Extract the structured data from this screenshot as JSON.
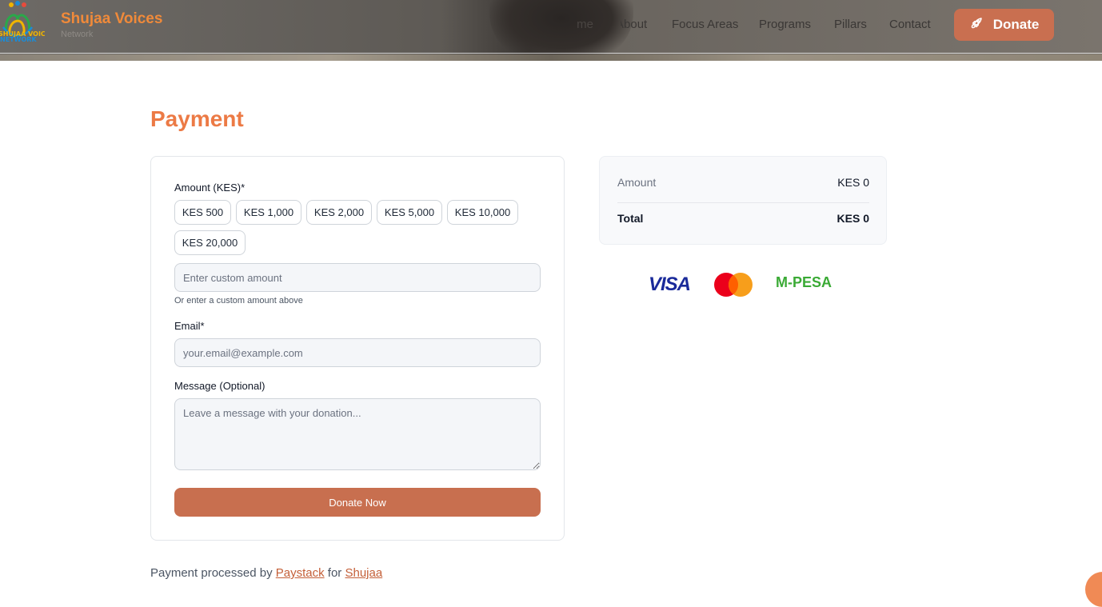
{
  "header": {
    "brand_title": "Shujaa Voices",
    "brand_subtitle": "Network",
    "logo_text": "SHUJAA VOICES NETWORK",
    "nav": {
      "home": "Home",
      "about": "About",
      "focus_areas": "Focus Areas",
      "programs": "Programs",
      "pillars": "Pillars",
      "contact": "Contact"
    },
    "donate_label": "Donate",
    "donate_icon": "rocket-icon"
  },
  "page_title": "Payment",
  "form": {
    "amount_label": "Amount (KES)*",
    "preset_amounts": [
      "KES 500",
      "KES 1,000",
      "KES 2,000",
      "KES 5,000",
      "KES 10,000",
      "KES 20,000"
    ],
    "custom_amount": {
      "value": "",
      "placeholder": "Enter custom amount"
    },
    "custom_hint": "Or enter a custom amount above",
    "email_label": "Email*",
    "email": {
      "value": "",
      "placeholder": "your.email@example.com"
    },
    "message_label": "Message (Optional)",
    "message": {
      "value": "",
      "placeholder": "Leave a message with your donation..."
    },
    "submit_label": "Donate Now"
  },
  "summary": {
    "amount_label": "Amount",
    "amount_value": "KES 0",
    "total_label": "Total",
    "total_value": "KES 0"
  },
  "payment_methods": {
    "visa": "VISA",
    "mastercard": "mastercard-logo",
    "mpesa": "M-PESA"
  },
  "footer": {
    "prefix": "Payment processed by",
    "processor": "Paystack",
    "middle": "for",
    "org": "Shujaa"
  },
  "colors": {
    "accent": "#ec7a45",
    "button": "#c86f4f",
    "brand": "#f08a3a"
  }
}
